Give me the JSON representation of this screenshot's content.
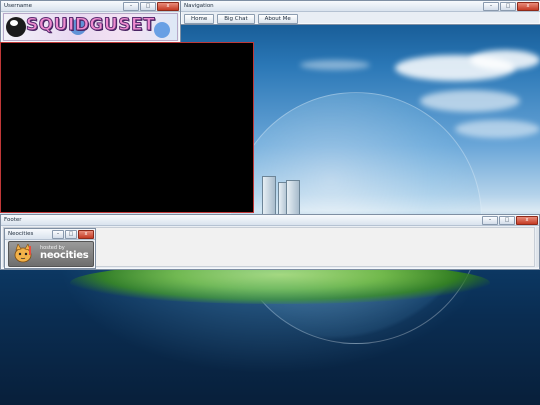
{
  "windows": {
    "username": {
      "title": "Username",
      "banner_text": "SQUIDGUSET"
    },
    "navigation": {
      "title": "Navigation",
      "links": [
        "Home",
        "Big Chat",
        "About Me"
      ]
    },
    "footer": {
      "title": "Footer"
    },
    "neocities": {
      "title": "Neocities",
      "badge_hosted_by": "hosted by",
      "badge_name": "neocities"
    }
  },
  "window_controls": {
    "minimize": "–",
    "maximize": "□",
    "close": "x"
  },
  "icons": [
    "minimize-icon",
    "maximize-icon",
    "close-icon",
    "neocities-cat-icon"
  ],
  "colors": {
    "close_button": "#c43b25",
    "video_border": "#c03838",
    "video_bg": "#000000"
  }
}
